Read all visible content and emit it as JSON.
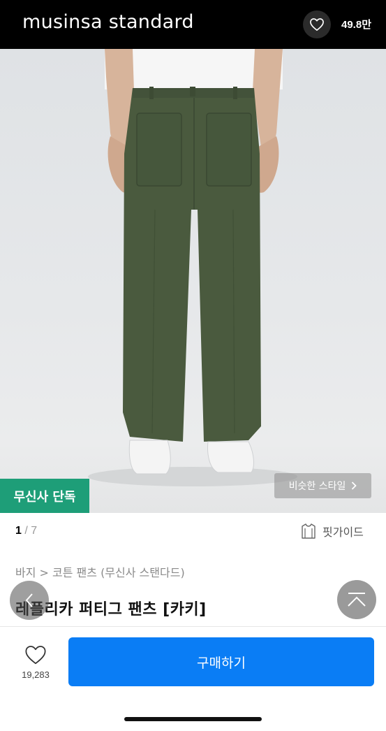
{
  "header": {
    "brand": "musinsa standard",
    "like_count": "49.8만"
  },
  "product": {
    "exclusive_badge": "무신사 단독",
    "similar_style_label": "비슷한 스타일",
    "pager_current": "1",
    "pager_total": " / 7",
    "fit_guide_label": "핏가이드",
    "breadcrumb": "바지 > 코튼 팬츠 (무신사 스탠다드)",
    "title": "레플리카 퍼티그 팬츠 [카키]"
  },
  "bottom": {
    "favorite_count": "19,283",
    "buy_label": "구매하기"
  },
  "colors": {
    "header_bg": "#000000",
    "badge_green": "#1e9e78",
    "buy_blue": "#0a7df5",
    "pants_khaki": "#4a5a3e"
  }
}
